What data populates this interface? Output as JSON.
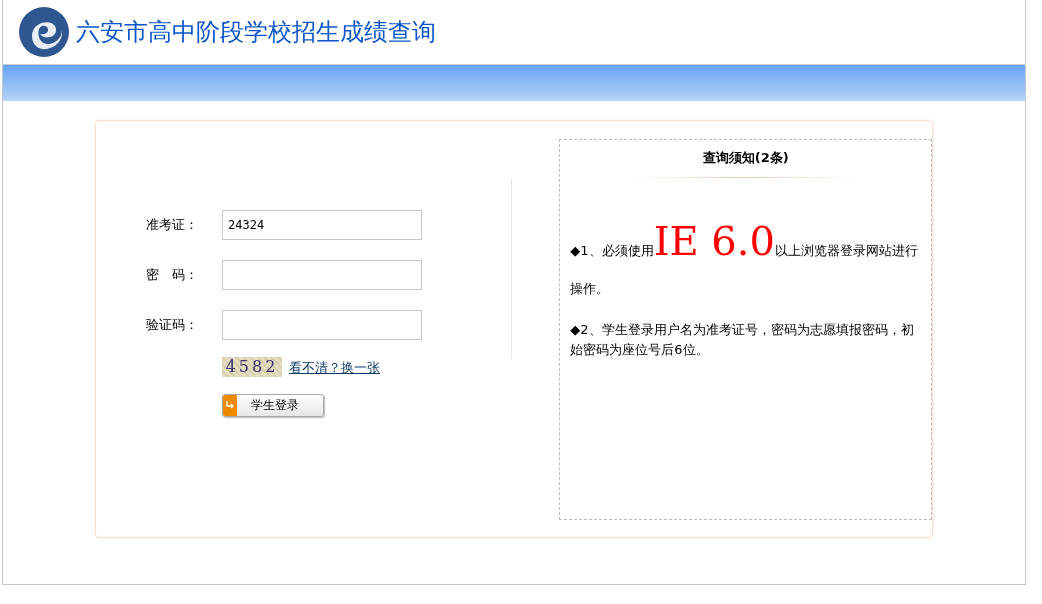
{
  "header": {
    "title": "六安市高中阶段学校招生成绩查询"
  },
  "login_form": {
    "fields": [
      {
        "label": "准考证：",
        "value": "24324",
        "kind": "text"
      },
      {
        "label": "密　码：",
        "kind": "password"
      },
      {
        "label": "验证码：",
        "kind": "text"
      }
    ],
    "captcha": {
      "code": "4582",
      "refresh_link": "看不清？换一张"
    },
    "submit_button": "学生登录"
  },
  "notice": {
    "title": "查询须知(2条)",
    "items": [
      {
        "parts": [
          {
            "text": "◆1、必须使用",
            "kind": "plain"
          },
          {
            "text": "IE 6.0",
            "kind": "highlight"
          },
          {
            "text": "以上浏览器登录网站进行操作。",
            "kind": "plain"
          }
        ]
      },
      {
        "parts": [
          {
            "text": "◆2、学生登录用户名为准考证号，密码为志愿填报密码，初始密码为座位号后6位。",
            "kind": "plain"
          }
        ]
      }
    ]
  }
}
